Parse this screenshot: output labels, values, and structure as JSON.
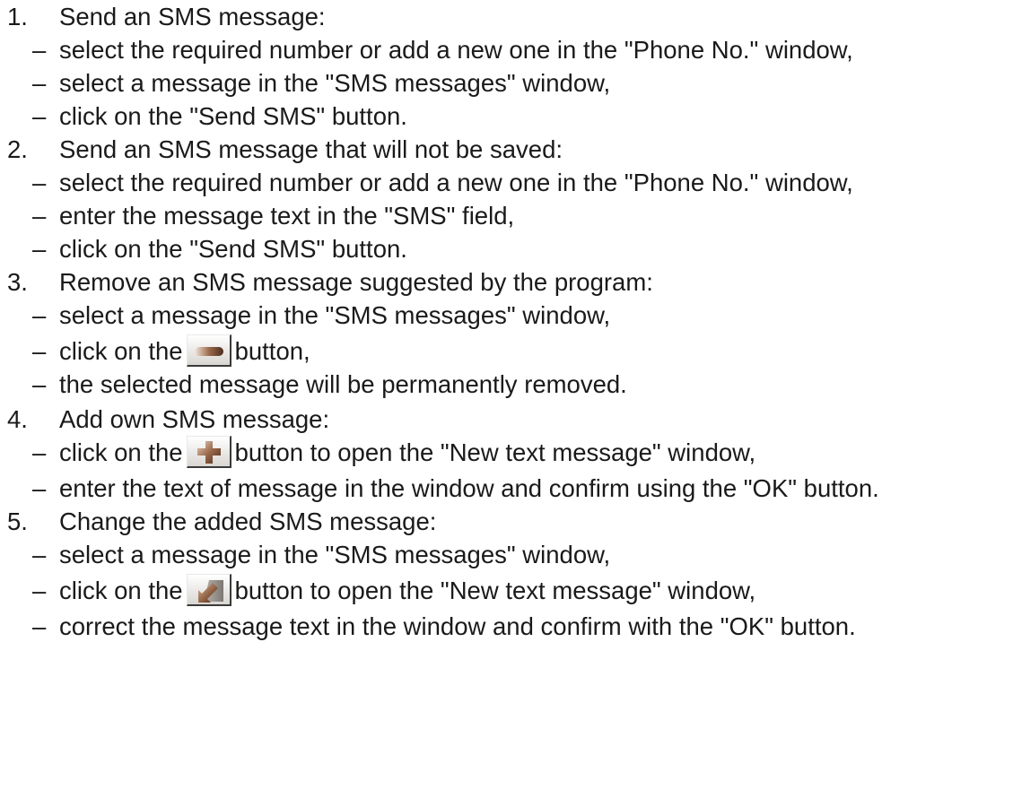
{
  "steps": [
    {
      "number": "1.",
      "title": "Send an SMS message:",
      "items": [
        {
          "dash": "–",
          "before": "select the required number or add a new one in the \"Phone No.\" window,"
        },
        {
          "dash": "–",
          "before": "select a message in the \"SMS messages\" window,"
        },
        {
          "dash": "–",
          "before": "click on the \"Send SMS\" button."
        }
      ]
    },
    {
      "number": "2.",
      "title": "Send an SMS message that will not be saved:",
      "items": [
        {
          "dash": "–",
          "before": "select the required number or add a new one in the \"Phone No.\" window,"
        },
        {
          "dash": "–",
          "before": "enter the message text in the \"SMS\" field,"
        },
        {
          "dash": "–",
          "before": "click on the \"Send SMS\" button."
        }
      ]
    },
    {
      "number": "3.",
      "title": "Remove an SMS message suggested by the program:",
      "items": [
        {
          "dash": "–",
          "before": "select a message in the \"SMS messages\" window,"
        },
        {
          "dash": "–",
          "before": "click on the",
          "icon": "minus-icon",
          "after": "button,"
        },
        {
          "dash": "–",
          "before": "the selected message will be permanently removed."
        }
      ]
    },
    {
      "number": "4.",
      "title": "Add own SMS message:",
      "items": [
        {
          "dash": "–",
          "before": "click on the",
          "icon": "plus-icon",
          "after": "button to open the \"New text message\" window,"
        },
        {
          "dash": "–",
          "before": "enter the text of message in the window and confirm using the \"OK\" button."
        }
      ]
    },
    {
      "number": "5.",
      "title": "Change the added SMS message:",
      "items": [
        {
          "dash": "–",
          "before": "select a message in the \"SMS messages\" window,"
        },
        {
          "dash": "–",
          "before": "click on the",
          "icon": "edit-arrow-icon",
          "after": "button to open the \"New text message\" window,"
        },
        {
          "dash": "–",
          "before": "correct the message text in the window and confirm with the \"OK\" button."
        }
      ]
    }
  ],
  "colors": {
    "text": "#1a1a1a",
    "icon_brown": "#8a5a3c",
    "icon_gray": "#9a9590"
  }
}
